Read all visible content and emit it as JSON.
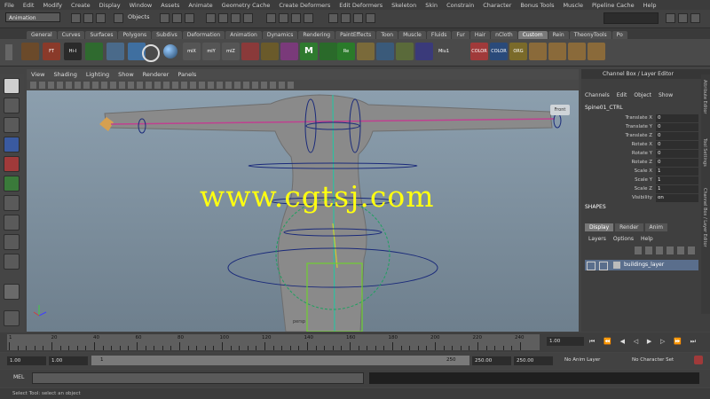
{
  "menubar": [
    "File",
    "Edit",
    "Modify",
    "Create",
    "Display",
    "Window",
    "Assets",
    "Animate",
    "Geometry Cache",
    "Create Deformers",
    "Edit Deformers",
    "Skeleton",
    "Skin",
    "Constrain",
    "Character",
    "Bonus Tools",
    "Muscle",
    "Pipeline Cache",
    "Help"
  ],
  "status": {
    "mode": "Animation",
    "objects_label": "Objects"
  },
  "shelf_tabs": [
    "General",
    "Curves",
    "Surfaces",
    "Polygons",
    "Subdivs",
    "Deformation",
    "Animation",
    "Dynamics",
    "Rendering",
    "PaintEffects",
    "Toon",
    "Muscle",
    "Fluids",
    "Fur",
    "Hair",
    "nCloth",
    "Custom",
    "Rein",
    "TheonyTools",
    "Po"
  ],
  "shelf_active": "Custom",
  "shelf_labels": [
    "FT",
    "Hi-I",
    "miX",
    "miY",
    "miZ",
    "Re",
    "COLOR",
    "ORG",
    "Miu1 CV pick",
    "COLOR CURVES"
  ],
  "viewport": {
    "menu": [
      "View",
      "Shading",
      "Lighting",
      "Show",
      "Renderer",
      "Panels"
    ],
    "watermark": "www.cgtsj.com",
    "front_label": "Front",
    "perspective_label": "persp"
  },
  "channel_box": {
    "title": "Channel Box / Layer Editor",
    "menu": [
      "Channels",
      "Edit",
      "Object",
      "Show"
    ],
    "object": "Spine01_CTRL",
    "attributes": [
      {
        "name": "Translate X",
        "value": "0"
      },
      {
        "name": "Translate Y",
        "value": "0"
      },
      {
        "name": "Translate Z",
        "value": "0"
      },
      {
        "name": "Rotate X",
        "value": "0"
      },
      {
        "name": "Rotate Y",
        "value": "0"
      },
      {
        "name": "Rotate Z",
        "value": "0"
      },
      {
        "name": "Scale X",
        "value": "1"
      },
      {
        "name": "Scale Y",
        "value": "1"
      },
      {
        "name": "Scale Z",
        "value": "1"
      },
      {
        "name": "Visibility",
        "value": "on"
      }
    ],
    "shapes_label": "SHAPES"
  },
  "layer_editor": {
    "tabs": [
      "Display",
      "Render",
      "Anim"
    ],
    "active_tab": "Display",
    "menu": [
      "Layers",
      "Options",
      "Help"
    ],
    "layer_name": "buildings_layer"
  },
  "timeline": {
    "ticks": [
      "1",
      "20",
      "40",
      "60",
      "80",
      "100",
      "120",
      "140",
      "160",
      "180",
      "200",
      "220",
      "240"
    ],
    "current_frame": "1.00"
  },
  "range": {
    "start_outer": "1.00",
    "start_inner": "1.00",
    "bar_start": "1",
    "bar_end": "250",
    "end_inner": "250.00",
    "end_outer": "250.00",
    "anim_layer": "No Anim Layer",
    "character_set": "No Character Set"
  },
  "cmdline": {
    "label": "MEL"
  },
  "helpline": "Select Tool: select an object",
  "side_tabs": [
    "Attribute Editor",
    "Tool Settings",
    "Channel Box / Layer Editor"
  ]
}
